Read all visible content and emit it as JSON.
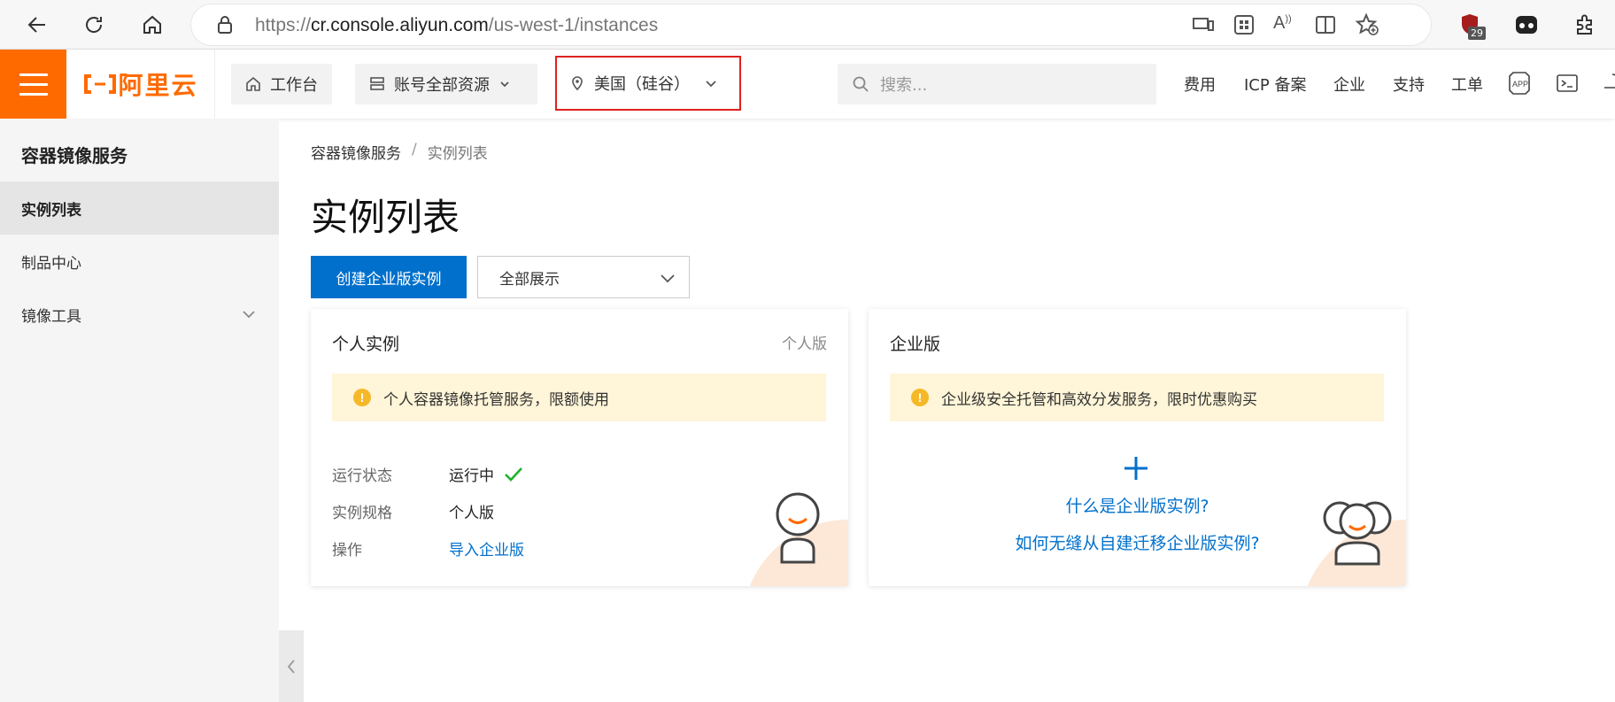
{
  "browser": {
    "url_scheme": "https://",
    "url_host": "cr.console.aliyun.com",
    "url_path": "/us-west-1/instances",
    "extension_badge": "29"
  },
  "header": {
    "logo_text": "阿里云",
    "workbench": "工作台",
    "resources": "账号全部资源",
    "region": "美国（硅谷）",
    "search_placeholder": "搜索...",
    "links": [
      "费用",
      "ICP 备案",
      "企业",
      "支持",
      "工单"
    ]
  },
  "sidebar": {
    "title": "容器镜像服务",
    "items": [
      {
        "label": "实例列表",
        "active": true
      },
      {
        "label": "制品中心",
        "active": false
      },
      {
        "label": "镜像工具",
        "active": false
      }
    ]
  },
  "main": {
    "breadcrumb": [
      "容器镜像服务",
      "实例列表"
    ],
    "breadcrumb_sep": "/",
    "title": "实例列表",
    "create_button": "创建企业版实例",
    "filter_select": "全部展示"
  },
  "cards": {
    "personal": {
      "title": "个人实例",
      "tag": "个人版",
      "notice": "个人容器镜像托管服务，限额使用",
      "rows": [
        {
          "label": "运行状态",
          "value": "运行中"
        },
        {
          "label": "实例规格",
          "value": "个人版"
        },
        {
          "label": "操作",
          "value": "导入企业版"
        }
      ]
    },
    "enterprise": {
      "title": "企业版",
      "notice": "企业级安全托管和高效分发服务，限时优惠购买",
      "link1": "什么是企业版实例?",
      "link2": "如何无缝从自建迁移企业版实例?"
    }
  },
  "colors": {
    "brand_orange": "#ff6a00",
    "primary_blue": "#0070cc",
    "notice_bg": "#fff5d8",
    "highlight_red": "#e02020",
    "success_green": "#1fb12c"
  }
}
